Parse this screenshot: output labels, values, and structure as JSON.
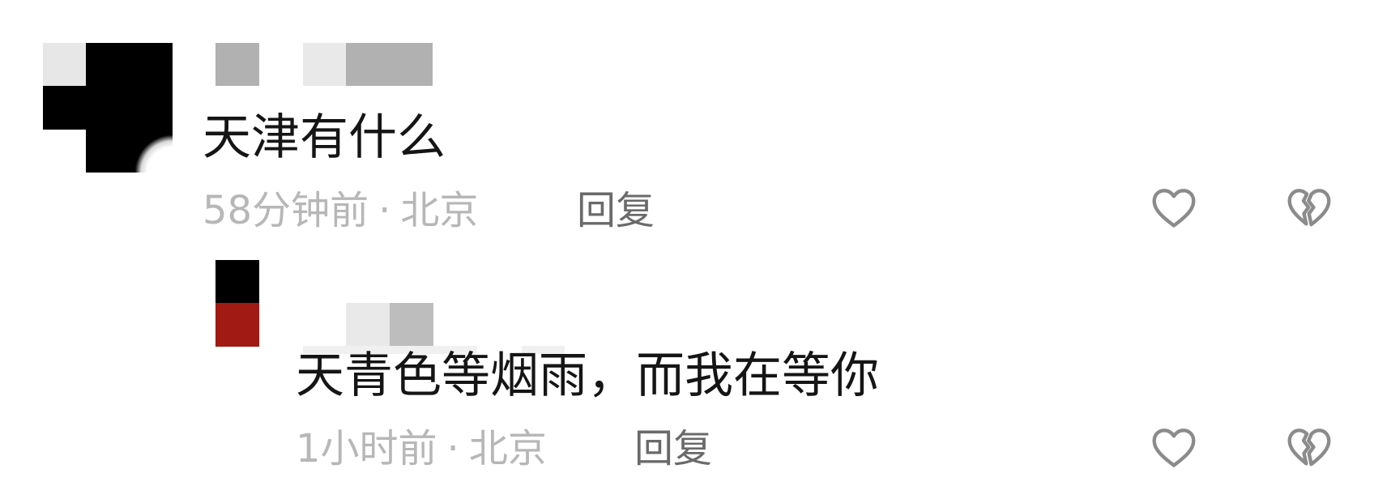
{
  "comment": {
    "text": "天津有什么",
    "time": "58分钟前",
    "separator": "·",
    "location": "北京",
    "reply_label": "回复",
    "like_icon": "heart-outline-icon",
    "dislike_icon": "broken-heart-icon"
  },
  "reply": {
    "text": "天青色等烟雨，而我在等你",
    "time": "1小时前",
    "separator": "·",
    "location": "北京",
    "reply_label": "回复",
    "like_icon": "heart-outline-icon",
    "dislike_icon": "broken-heart-icon"
  },
  "colors": {
    "text": "#151515",
    "meta": "#b7b7b7",
    "reply_label": "#6a6a6a",
    "icon": "#8b8b8b",
    "avatar_red": "#a11a13"
  }
}
